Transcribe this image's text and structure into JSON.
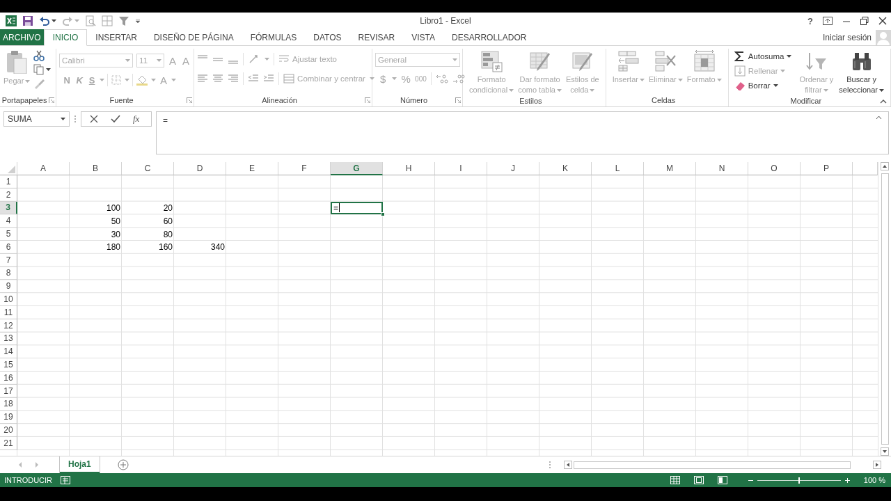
{
  "window": {
    "title": "Libro1 - Excel",
    "help": "?"
  },
  "tabs": [
    {
      "label": "ARCHIVO",
      "kind": "file",
      "selected": false
    },
    {
      "label": "INICIO",
      "kind": "tab",
      "selected": true
    },
    {
      "label": "INSERTAR",
      "kind": "tab",
      "selected": false
    },
    {
      "label": "DISEÑO DE PÁGINA",
      "kind": "tab",
      "selected": false
    },
    {
      "label": "FÓRMULAS",
      "kind": "tab",
      "selected": false
    },
    {
      "label": "DATOS",
      "kind": "tab",
      "selected": false
    },
    {
      "label": "REVISAR",
      "kind": "tab",
      "selected": false
    },
    {
      "label": "VISTA",
      "kind": "tab",
      "selected": false
    },
    {
      "label": "DESARROLLADOR",
      "kind": "tab",
      "selected": false
    }
  ],
  "account": {
    "label": "Iniciar sesión"
  },
  "ribbon": {
    "groups": [
      {
        "name": "Portapapeles",
        "kind": "clipboard",
        "dialog_launcher": true,
        "items": [
          {
            "label": [
              "Pegar"
            ],
            "disabled": true
          }
        ]
      },
      {
        "name": "Fuente",
        "kind": "font",
        "dialog_launcher": true,
        "font": "Calibri",
        "size": "11",
        "buttons": [
          {
            "label": "A",
            "kind": "grow",
            "disabled": true
          },
          {
            "label": "A",
            "kind": "shrink",
            "disabled": true
          },
          {
            "label": "N",
            "kind": "bold",
            "disabled": true
          },
          {
            "label": "K",
            "kind": "italic",
            "disabled": true
          },
          {
            "label": "S",
            "kind": "underline",
            "disabled": true
          },
          {
            "label": "A",
            "kind": "color",
            "disabled": true
          }
        ]
      },
      {
        "name": "Alineación",
        "kind": "alignment",
        "dialog_launcher": true,
        "items": [
          {
            "label": "Ajustar texto",
            "disabled": true
          },
          {
            "label": "Combinar y centrar",
            "disabled": true
          }
        ]
      },
      {
        "name": "Número",
        "kind": "number",
        "dialog_launcher": true,
        "format": "General",
        "buttons": [
          {
            "label": "$",
            "disabled": true
          },
          {
            "label": "%",
            "disabled": true
          },
          {
            "label": "000",
            "disabled": true
          }
        ]
      },
      {
        "name": "Estilos",
        "kind": "large",
        "items": [
          {
            "label": [
              "Formato",
              "condicional"
            ],
            "disabled": true
          },
          {
            "label": [
              "Dar formato",
              "como tabla"
            ],
            "disabled": true
          },
          {
            "label": [
              "Estilos de",
              "celda"
            ],
            "disabled": true
          }
        ]
      },
      {
        "name": "Celdas",
        "kind": "large",
        "items": [
          {
            "label": [
              "Insertar"
            ],
            "disabled": true
          },
          {
            "label": [
              "Eliminar"
            ],
            "disabled": true
          },
          {
            "label": [
              "Formato"
            ],
            "disabled": true
          }
        ]
      },
      {
        "name": "Modificar",
        "kind": "edit",
        "items": [
          {
            "label": [
              "Autosuma"
            ],
            "kind": "small",
            "disabled": false
          },
          {
            "label": [
              "Rellenar"
            ],
            "kind": "small",
            "disabled": true
          },
          {
            "label": [
              "Borrar"
            ],
            "kind": "small",
            "disabled": false
          },
          {
            "label": [
              "Ordenar y",
              "filtrar"
            ],
            "kind": "large",
            "disabled": true
          },
          {
            "label": [
              "Buscar y",
              "seleccionar"
            ],
            "kind": "large",
            "disabled": false
          }
        ]
      }
    ]
  },
  "formula_bar": {
    "name_box": "SUMA",
    "function_button": "fx",
    "formula": "="
  },
  "sheet": {
    "columns": [
      {
        "label": "A",
        "selected": false
      },
      {
        "label": "B",
        "selected": false
      },
      {
        "label": "C",
        "selected": false
      },
      {
        "label": "D",
        "selected": false
      },
      {
        "label": "E",
        "selected": false
      },
      {
        "label": "F",
        "selected": false
      },
      {
        "label": "G",
        "selected": true
      },
      {
        "label": "H",
        "selected": false
      },
      {
        "label": "I",
        "selected": false
      },
      {
        "label": "J",
        "selected": false
      },
      {
        "label": "K",
        "selected": false
      },
      {
        "label": "L",
        "selected": false
      },
      {
        "label": "M",
        "selected": false
      },
      {
        "label": "N",
        "selected": false
      },
      {
        "label": "O",
        "selected": false
      },
      {
        "label": "P",
        "selected": false
      }
    ],
    "rows": [
      {
        "header": "1",
        "selected": false
      },
      {
        "header": "2",
        "selected": false
      },
      {
        "header": "3",
        "selected": true,
        "cells": [
          null,
          "100",
          "20",
          null,
          null,
          null,
          "="
        ]
      },
      {
        "header": "4",
        "selected": false,
        "cells": [
          null,
          "50",
          "60"
        ]
      },
      {
        "header": "5",
        "selected": false,
        "cells": [
          null,
          "30",
          "80"
        ]
      },
      {
        "header": "6",
        "selected": false,
        "cells": [
          null,
          "180",
          "160",
          "340"
        ]
      },
      {
        "header": "7",
        "selected": false
      },
      {
        "header": "8",
        "selected": false
      },
      {
        "header": "9",
        "selected": false
      },
      {
        "header": "10",
        "selected": false
      },
      {
        "header": "11",
        "selected": false
      },
      {
        "header": "12",
        "selected": false
      },
      {
        "header": "13",
        "selected": false
      },
      {
        "header": "14",
        "selected": false
      },
      {
        "header": "15",
        "selected": false
      },
      {
        "header": "16",
        "selected": false
      },
      {
        "header": "17",
        "selected": false
      },
      {
        "header": "18",
        "selected": false
      },
      {
        "header": "19",
        "selected": false
      },
      {
        "header": "20",
        "selected": false
      },
      {
        "header": "21",
        "selected": false
      }
    ]
  },
  "sheet_tabs": [
    {
      "label": "Hoja1",
      "selected": true
    }
  ],
  "status_bar": {
    "mode": "INTRODUCIR",
    "zoom": {
      "level": 0.5,
      "reading": "100 %"
    }
  }
}
